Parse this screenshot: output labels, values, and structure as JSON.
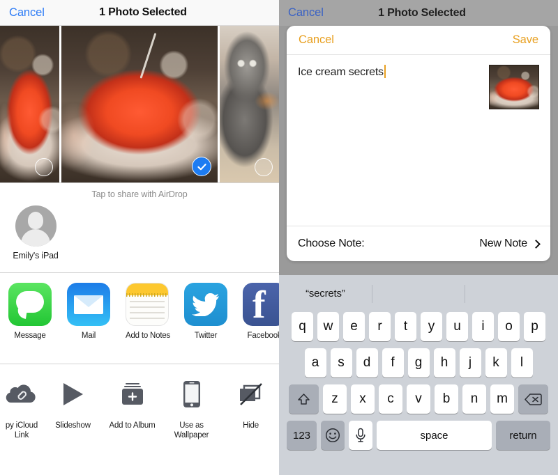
{
  "left": {
    "nav": {
      "cancel": "Cancel",
      "title": "1 Photo Selected"
    },
    "photos": [
      {
        "name": "shaved-ice-partial",
        "selected": false
      },
      {
        "name": "shaved-ice-bowl",
        "selected": true
      },
      {
        "name": "grey-cat",
        "selected": false
      }
    ],
    "airdrop": {
      "hint": "Tap to share with AirDrop",
      "device": "Emily's iPad"
    },
    "apps": [
      {
        "label": "Message",
        "icon": "message-icon"
      },
      {
        "label": "Mail",
        "icon": "mail-icon"
      },
      {
        "label": "Add to Notes",
        "icon": "notes-icon"
      },
      {
        "label": "Twitter",
        "icon": "twitter-icon"
      },
      {
        "label": "Facebook",
        "icon": "facebook-icon"
      }
    ],
    "actions": [
      {
        "label": "py iCloud Link",
        "icon": "icloud-link-icon"
      },
      {
        "label": "Slideshow",
        "icon": "play-icon"
      },
      {
        "label": "Add to Album",
        "icon": "add-to-album-icon"
      },
      {
        "label": "Use as Wallpaper",
        "icon": "phone-icon"
      },
      {
        "label": "Hide",
        "icon": "hide-icon"
      }
    ]
  },
  "right": {
    "nav": {
      "cancel": "Cancel",
      "title": "1 Photo Selected"
    },
    "sheet": {
      "cancel": "Cancel",
      "save": "Save",
      "note_text": "Ice cream secrets",
      "choose_label": "Choose Note:",
      "choose_value": "New Note",
      "chevron": "chevron-right-icon",
      "attachment": "shaved-ice-thumbnail"
    },
    "keyboard": {
      "predictions": [
        "“secrets”",
        "",
        ""
      ],
      "row1": [
        "q",
        "w",
        "e",
        "r",
        "t",
        "y",
        "u",
        "i",
        "o",
        "p"
      ],
      "row2": [
        "a",
        "s",
        "d",
        "f",
        "g",
        "h",
        "j",
        "k",
        "l"
      ],
      "row3": [
        "z",
        "x",
        "c",
        "v",
        "b",
        "n",
        "m"
      ],
      "shift": "shift-icon",
      "backspace": "backspace-icon",
      "numbers": "123",
      "emoji": "emoji-icon",
      "dictation": "microphone-icon",
      "space": "space",
      "return": "return"
    }
  },
  "colors": {
    "ios_blue": "#2d7cf6",
    "notes_orange": "#e8a021",
    "select_blue": "#1d7cf2",
    "keyboard_bg": "#ced2d8"
  }
}
